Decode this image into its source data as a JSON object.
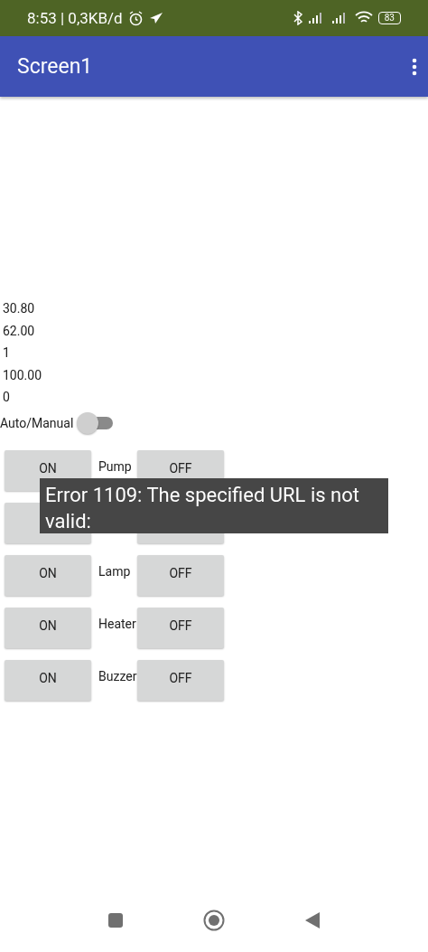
{
  "status_bar": {
    "time": "8:53 | 0,3KB/d",
    "battery": "83"
  },
  "app_bar": {
    "title": "Screen1"
  },
  "readings": [
    "30.80",
    "62.00",
    "1",
    "100.00",
    "0"
  ],
  "mode_switch": {
    "label": "Auto/Manual",
    "on": false
  },
  "device_rows": [
    {
      "kind": "labeled",
      "on_label": "ON",
      "name": "Pump",
      "off_label": "OFF"
    },
    {
      "kind": "covered"
    },
    {
      "kind": "labeled",
      "on_label": "ON",
      "name": "Lamp",
      "off_label": "OFF"
    },
    {
      "kind": "labeled",
      "on_label": "ON",
      "name": "Heater",
      "off_label": "OFF"
    },
    {
      "kind": "labeled",
      "on_label": "ON",
      "name": "Buzzer",
      "off_label": "OFF"
    }
  ],
  "toast": {
    "message": "Error 1109: The specified URL is not valid:"
  }
}
